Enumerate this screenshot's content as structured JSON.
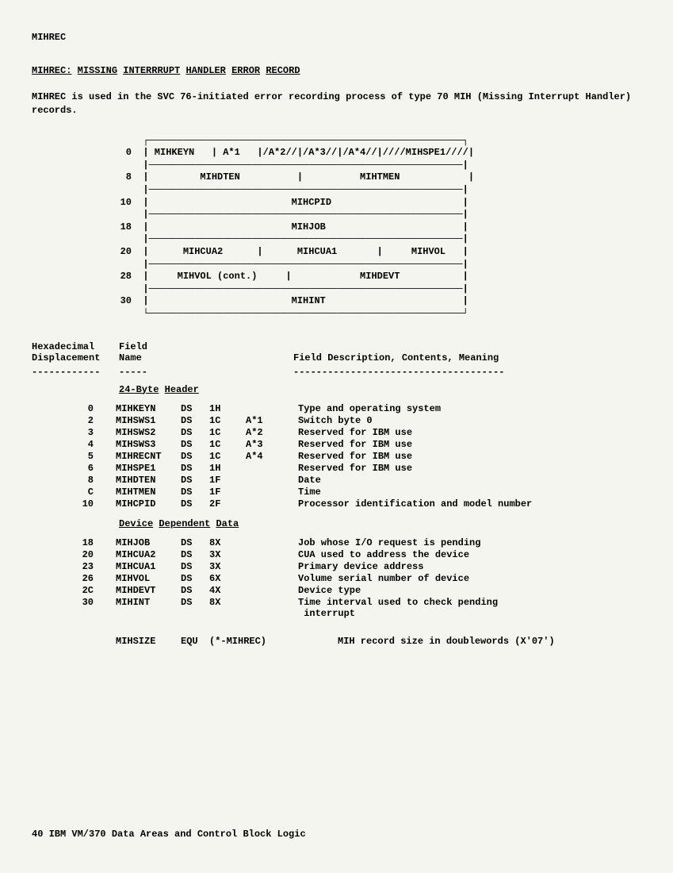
{
  "header_name": "MIHREC",
  "section_title_label": "MIHREC:",
  "section_title_words": [
    "MISSING",
    "INTERRRUPT",
    "HANDLER",
    "ERROR",
    "RECORD"
  ],
  "description": "MIHREC is used  in the SVC 76-initiated error  recording process of type  70 MIH (Missing Interrupt Handler) records.",
  "diagram_lines": [
    "       ┌───────────────────────────────────────────────────────┐",
    "    0  | MIHKEYN   | A*1   |/A*2//|/A*3//|/A*4//|////MIHSPE1////|",
    "       |───────────────────────────────────────────────────────|",
    "    8  |         MIHDTEN          |          MIHTMEN            |",
    "       |───────────────────────────────────────────────────────|",
    "   10  |                         MIHCPID                       |",
    "       |───────────────────────────────────────────────────────|",
    "   18  |                         MIHJOB                        |",
    "       |───────────────────────────────────────────────────────|",
    "   20  |      MIHCUA2      |      MIHCUA1       |     MIHVOL   |",
    "       |───────────────────────────────────────────────────────|",
    "   28  |     MIHVOL (cont.)     |            MIHDEVT           |",
    "       |───────────────────────────────────────────────────────|",
    "   30  |                         MIHINT                        |",
    "       └───────────────────────────────────────────────────────┘"
  ],
  "col_headers": {
    "col1a": "Hexadecimal",
    "col1b": "Displacement",
    "col2a": "Field",
    "col2b": "Name",
    "col3": "Field Description, Contents, Meaning"
  },
  "dashes": {
    "d1": "------------",
    "d2": "-----",
    "d3": "-------------------------------------"
  },
  "subsection1_words": [
    "24-Byte",
    "Header"
  ],
  "fields1": [
    {
      "offset": "0",
      "name": "MIHKEYN",
      "ds": "DS",
      "size": "1H",
      "note": "",
      "desc": "Type and operating system"
    },
    {
      "offset": "2",
      "name": "MIHSWS1",
      "ds": "DS",
      "size": "1C",
      "note": "A*1",
      "desc": "Switch byte 0"
    },
    {
      "offset": "3",
      "name": "MIHSWS2",
      "ds": "DS",
      "size": "1C",
      "note": "A*2",
      "desc": "Reserved for IBM use"
    },
    {
      "offset": "4",
      "name": "MIHSWS3",
      "ds": "DS",
      "size": "1C",
      "note": "A*3",
      "desc": "Reserved for IBM use"
    },
    {
      "offset": "5",
      "name": "MIHRECNT",
      "ds": "DS",
      "size": "1C",
      "note": "A*4",
      "desc": "Reserved for IBM use"
    },
    {
      "offset": "6",
      "name": "MIHSPE1",
      "ds": "DS",
      "size": "1H",
      "note": "",
      "desc": "Reserved for IBM use"
    },
    {
      "offset": "8",
      "name": "MIHDTEN",
      "ds": "DS",
      "size": "1F",
      "note": "",
      "desc": "Date"
    },
    {
      "offset": "C",
      "name": "MIHTMEN",
      "ds": "DS",
      "size": "1F",
      "note": "",
      "desc": "Time"
    },
    {
      "offset": "10",
      "name": "MIHCPID",
      "ds": "DS",
      "size": "2F",
      "note": "",
      "desc": "Processor identification and model number"
    }
  ],
  "subsection2_words": [
    "Device",
    "Dependent",
    "Data"
  ],
  "fields2": [
    {
      "offset": "18",
      "name": "MIHJOB",
      "ds": "DS",
      "size": "8X",
      "note": "",
      "desc": "Job whose I/O request is pending"
    },
    {
      "offset": "20",
      "name": "MIHCUA2",
      "ds": "DS",
      "size": "3X",
      "note": "",
      "desc": "CUA used to address the device"
    },
    {
      "offset": "23",
      "name": "MIHCUA1",
      "ds": "DS",
      "size": "3X",
      "note": "",
      "desc": "Primary device address"
    },
    {
      "offset": "26",
      "name": "MIHVOL",
      "ds": "DS",
      "size": "6X",
      "note": "",
      "desc": "Volume serial number of device"
    },
    {
      "offset": "2C",
      "name": "MIHDEVT",
      "ds": "DS",
      "size": "4X",
      "note": "",
      "desc": "Device type"
    },
    {
      "offset": "30",
      "name": "MIHINT",
      "ds": "DS",
      "size": "8X",
      "note": "",
      "desc": "Time interval used to check pending\n interrupt"
    }
  ],
  "fields3": [
    {
      "offset": "",
      "name": "MIHSIZE",
      "ds": "EQU",
      "size": "(*-MIHREC)",
      "note": "",
      "desc": "MIH record size in doublewords (X'07')"
    }
  ],
  "footer": "40  IBM VM/370 Data Areas and Control Block Logic"
}
